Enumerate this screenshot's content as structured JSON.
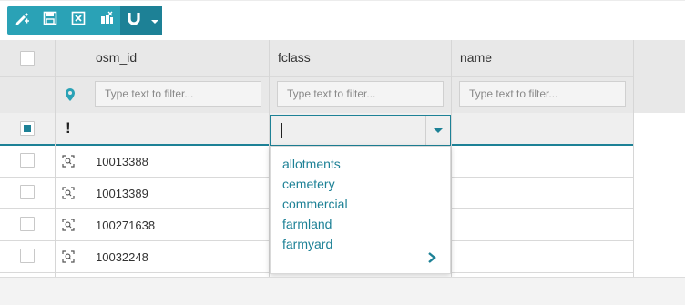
{
  "toolbar": {
    "buttons": [
      {
        "name": "edit-pencil-icon"
      },
      {
        "name": "save-icon"
      },
      {
        "name": "discard-icon"
      },
      {
        "name": "delete-features-icon"
      },
      {
        "name": "snapping-magnet-icon"
      }
    ],
    "accent": "#2aa2b6",
    "accent_dark": "#1d8196"
  },
  "table": {
    "columns": [
      "osm_id",
      "fclass",
      "name"
    ],
    "filter_placeholder": "Type text to filter...",
    "new_row_marker": "!",
    "rows": [
      {
        "osm_id": "10013388",
        "fclass": "",
        "name": ""
      },
      {
        "osm_id": "10013389",
        "fclass": "",
        "name": ""
      },
      {
        "osm_id": "100271638",
        "fclass": "",
        "name": ""
      },
      {
        "osm_id": "10032248",
        "fclass": "",
        "name": ""
      }
    ]
  },
  "fclass_dropdown": {
    "value": "",
    "options": [
      "allotments",
      "cemetery",
      "commercial",
      "farmland",
      "farmyard"
    ]
  }
}
